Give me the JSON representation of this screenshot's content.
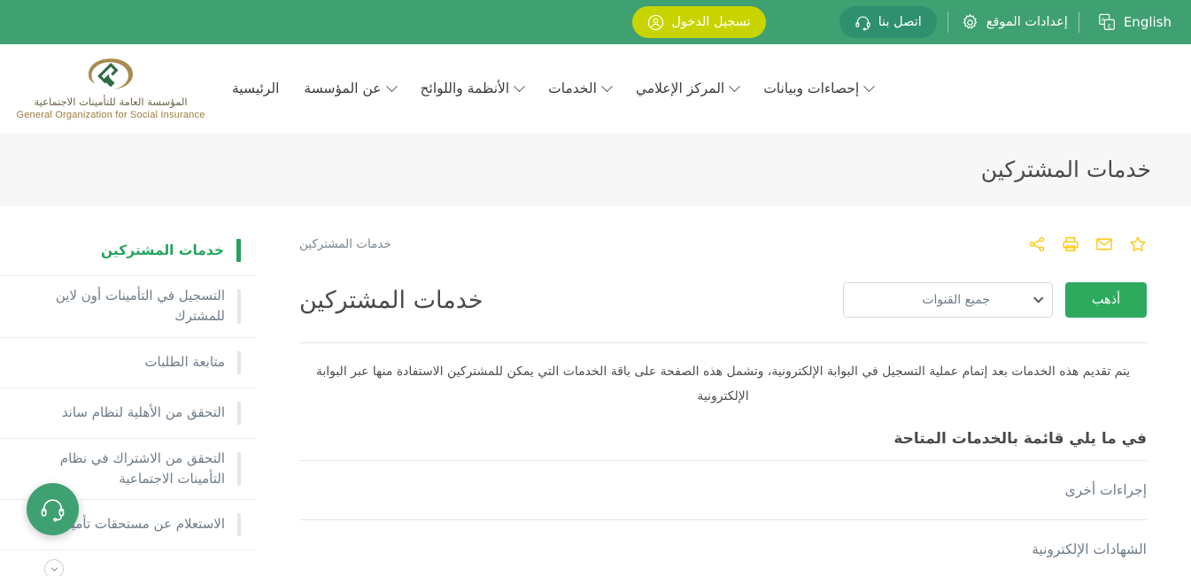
{
  "topbar": {
    "login_label": "تسجيل الدخول",
    "contact_label": "اتصل بنا",
    "settings_label": "إعدادات الموقع",
    "language_label": "English",
    "bg_color": "#3fa072",
    "login_color": "#c8d400",
    "contact_color": "#2f9070"
  },
  "header": {
    "logo_ar": "المؤسسة العامة للتأمينات الاجتماعية",
    "logo_en": "General Organization for Social Insurance",
    "nav": [
      {
        "label": "الرئيسية",
        "has_chevron": false
      },
      {
        "label": "عن المؤسسة",
        "has_chevron": true
      },
      {
        "label": "الأنظمة واللوائح",
        "has_chevron": true
      },
      {
        "label": "الخدمات",
        "has_chevron": true
      },
      {
        "label": "المركز الإعلامي",
        "has_chevron": true
      },
      {
        "label": "إحصاءات وبيانات",
        "has_chevron": true
      }
    ]
  },
  "banner": {
    "title": "خدمات المشتركين",
    "bg_color": "#f7f7f7"
  },
  "sidebar": {
    "items": [
      {
        "label": "خدمات المشتركين",
        "active": true
      },
      {
        "label": "التسجيل في التأمينات أون لاين للمشترك",
        "active": false
      },
      {
        "label": "متابعة الطلبات",
        "active": false
      },
      {
        "label": "التحقق من الأهلية لنظام ساند",
        "active": false
      },
      {
        "label": "التحقق من الاشتراك في نظام التأمينات الاجتماعية",
        "active": false
      },
      {
        "label": "الاستعلام عن مستحقات تأمينية",
        "active": false
      }
    ],
    "active_color": "#22a45d"
  },
  "content": {
    "breadcrumb": "خدمات المشتركين",
    "action_icons": [
      {
        "name": "favorite-star-icon",
        "title": "إضافة للمفضلة"
      },
      {
        "name": "email-icon",
        "title": "إرسال بالبريد"
      },
      {
        "name": "print-icon",
        "title": "طباعة"
      },
      {
        "name": "share-icon",
        "title": "مشاركة"
      }
    ],
    "icon_color": "#ffc400",
    "title": "خدمات المشتركين",
    "channel_select": {
      "value": "جميع القنوات",
      "placeholder": "جميع القنوات"
    },
    "go_button": "أذهب",
    "intro": "يتم تقديم هذه الخدمات بعد إتمام عملية التسجيل في البوابة الإلكترونية، وتشمل هذه الصفحة على باقة الخدمات التي يمكن للمشتركين الاستفادة منها عبر البوابة الإلكترونية",
    "list_heading": "في ما يلي قائمة بالخدمات المتاحة",
    "list_items": [
      {
        "label": "إجراءات أخرى"
      },
      {
        "label": "الشهادات الإلكترونية"
      }
    ]
  },
  "widgets": {
    "chat_icon": "headset-icon",
    "chat_color": "#3fa072",
    "scroll_icon": "chevron-down-icon"
  }
}
